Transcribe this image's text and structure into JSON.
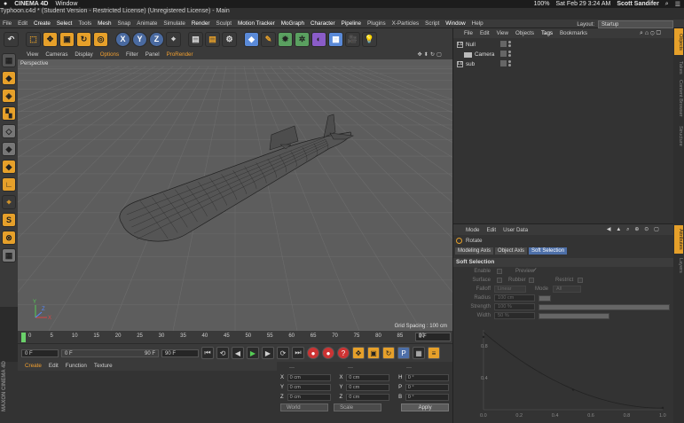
{
  "macbar": {
    "apple": "",
    "app": "CINEMA 4D",
    "menu": "Window",
    "battery": "100%",
    "datetime": "Sat Feb 29  3:24 AM",
    "user": "Scott Sandifer"
  },
  "window": {
    "title": "Typhoon.c4d * (Student Version - Restricted License) (Unregistered License) - Main"
  },
  "c4dmenu": [
    "File",
    "Edit",
    "Create",
    "Select",
    "Tools",
    "Mesh",
    "Snap",
    "Animate",
    "Simulate",
    "Render",
    "Sculpt",
    "Motion Tracker",
    "MoGraph",
    "Character",
    "Pipeline",
    "Plugins",
    "X-Particles",
    "Script",
    "Window",
    "Help"
  ],
  "layout": {
    "label": "Layout:",
    "value": "Startup"
  },
  "viewport": {
    "menu": [
      "View",
      "Cameras",
      "Display",
      "Options",
      "Filter",
      "Panel",
      "ProRender"
    ],
    "label": "Perspective",
    "grid_spacing": "Grid Spacing : 100 cm",
    "axes": {
      "x": "X",
      "y": "Y",
      "z": "Z"
    }
  },
  "timeline": {
    "ticks": [
      "0",
      "5",
      "10",
      "15",
      "20",
      "25",
      "30",
      "35",
      "40",
      "45",
      "50",
      "55",
      "60",
      "65",
      "70",
      "75",
      "80",
      "85",
      "90"
    ],
    "end_field": "0 F"
  },
  "transport": {
    "start": "0 F",
    "range_start": "0 F",
    "range_end": "90 F",
    "end": "90 F"
  },
  "materials": {
    "menu": [
      "Create",
      "Edit",
      "Function",
      "Texture"
    ]
  },
  "logo": "MAXON CINEMA 4D",
  "coords": {
    "header": [
      "---",
      "---",
      "---"
    ],
    "rows": [
      {
        "a": "X",
        "av": "0 cm",
        "b": "X",
        "bv": "0 cm",
        "c": "H",
        "cv": "0 °"
      },
      {
        "a": "Y",
        "av": "0 cm",
        "b": "Y",
        "bv": "0 cm",
        "c": "P",
        "cv": "0 °"
      },
      {
        "a": "Z",
        "av": "0 cm",
        "b": "Z",
        "bv": "0 cm",
        "c": "B",
        "cv": "0 °"
      }
    ],
    "world": "World",
    "scale": "Scale",
    "apply": "Apply"
  },
  "objects": {
    "menu": [
      "File",
      "Edit",
      "View",
      "Objects",
      "Tags",
      "Bookmarks"
    ],
    "rows": [
      {
        "name": "Null",
        "indent": 0
      },
      {
        "name": "Camera",
        "indent": 1
      },
      {
        "name": "sub",
        "indent": 0
      }
    ]
  },
  "attributes": {
    "menu": [
      "Mode",
      "Edit",
      "User Data"
    ],
    "object": "Rotate",
    "tabs": [
      "Modeling Axis",
      "Object Axis",
      "Soft Selection"
    ],
    "section": "Soft Selection",
    "enable": "Enable",
    "preview": "Preview",
    "preview_check": "✓",
    "surface": "Surface",
    "rubber": "Rubber",
    "restrict": "Restrict",
    "falloff_label": "Falloff",
    "falloff": "Linear",
    "mode_label": "Mode",
    "mode": "All",
    "radius_label": "Radius",
    "radius": "100 cm",
    "strength_label": "Strength",
    "strength": "100 %",
    "width_label": "Width",
    "width": "50 %",
    "curve_y_ticks": [
      "0.8",
      "0.4"
    ],
    "curve_x_ticks": [
      "0.0",
      "0.2",
      "0.4",
      "0.6",
      "0.8",
      "1.0"
    ]
  },
  "righttabs": [
    "Objects",
    "Takes",
    "Content Browser",
    "Structure",
    "Attributes",
    "Layers"
  ]
}
